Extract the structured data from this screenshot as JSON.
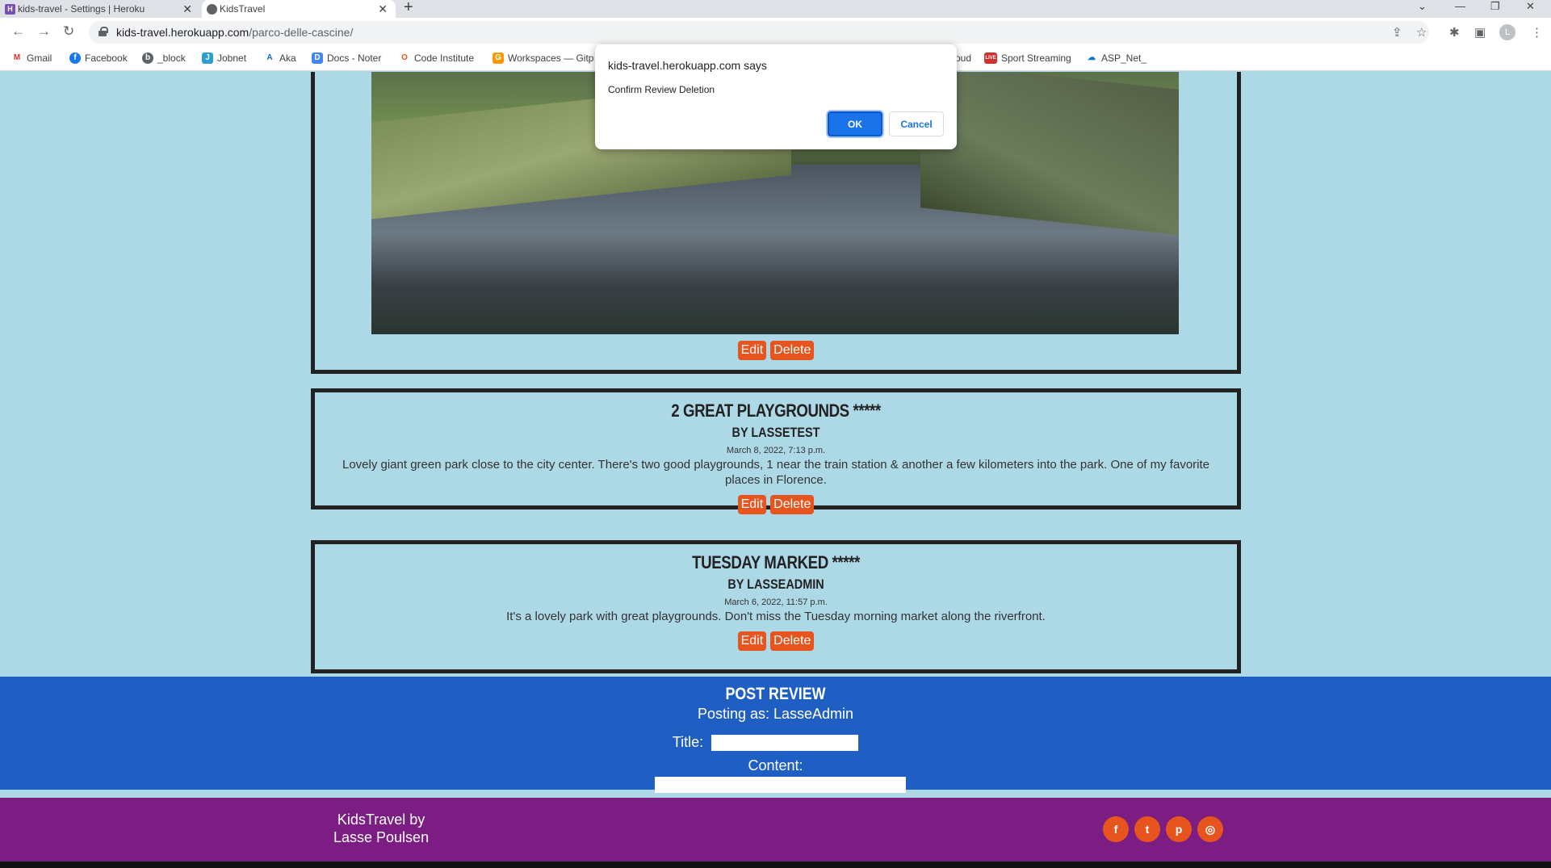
{
  "browser": {
    "tabs": [
      {
        "label": "kids-travel - Settings | Heroku",
        "favicon": "heroku-icon"
      },
      {
        "label": "KidsTravel",
        "favicon": "globe-icon"
      }
    ],
    "url_host": "kids-travel.herokuapp.com",
    "url_path": "/parco-delle-cascine/",
    "profile_initial": "L",
    "bookmarks": [
      {
        "label": "Gmail",
        "icon": "M"
      },
      {
        "label": "Facebook",
        "icon": "f"
      },
      {
        "label": "_block",
        "icon": "b"
      },
      {
        "label": "Jobnet",
        "icon": "J"
      },
      {
        "label": "Aka",
        "icon": "A"
      },
      {
        "label": "Docs - Noter",
        "icon": "D"
      },
      {
        "label": "Code Institute",
        "icon": "O"
      },
      {
        "label": "Workspaces — Gitp",
        "icon": "G"
      },
      {
        "label": "oud",
        "icon": ""
      },
      {
        "label": "Sport Streaming",
        "icon": "LIVE"
      },
      {
        "label": "ASP_Net_",
        "icon": "☁"
      }
    ]
  },
  "dialog": {
    "title": "kids-travel.herokuapp.com says",
    "message": "Confirm Review Deletion",
    "ok_label": "OK",
    "cancel_label": "Cancel"
  },
  "reviews": [
    {
      "edit_label": "Edit",
      "delete_label": "Delete"
    },
    {
      "title": "2 GREAT PLAYGROUNDS *****",
      "author": "BY LASSETEST",
      "date": "March 8, 2022, 7:13 p.m.",
      "content": "Lovely giant green park close to the city center. There's two good playgrounds, 1 near the train station & another a few kilometers into the park. One of my favorite places in Florence.",
      "edit_label": "Edit",
      "delete_label": "Delete"
    },
    {
      "title": "TUESDAY MARKED *****",
      "author": "BY LASSEADMIN",
      "date": "March 6, 2022, 11:57 p.m.",
      "content": "It's a lovely park with great playgrounds. Don't miss the Tuesday morning market along the riverfront.",
      "edit_label": "Edit",
      "delete_label": "Delete"
    }
  ],
  "post_review": {
    "heading": "POST REVIEW",
    "posting_as": "Posting as: LasseAdmin",
    "title_label": "Title:",
    "content_label": "Content:"
  },
  "footer": {
    "brand_line1": "KidsTravel by",
    "brand_line2": "Lasse Poulsen",
    "social": [
      {
        "name": "facebook-icon",
        "glyph": "f"
      },
      {
        "name": "twitter-icon",
        "glyph": "t"
      },
      {
        "name": "pinterest-icon",
        "glyph": "p"
      },
      {
        "name": "instagram-icon",
        "glyph": "◎"
      }
    ]
  },
  "colors": {
    "page_bg": "#add8e6",
    "button_accent": "#e8541e",
    "post_section_bg": "#1f5fc4",
    "footer_bg": "#7b1d82",
    "dialog_ok": "#1a73e8"
  }
}
